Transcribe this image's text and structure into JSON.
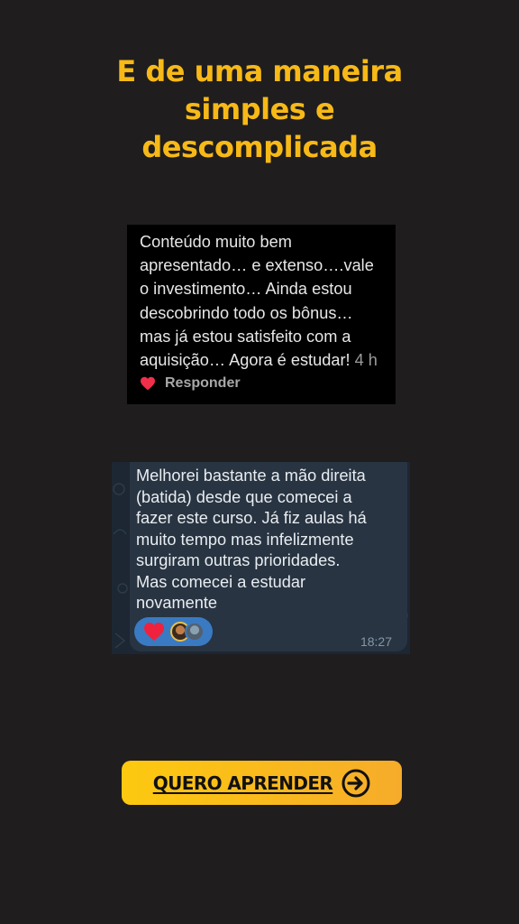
{
  "headline": {
    "lines": [
      "E de uma maneira",
      "simples e",
      "descomplicada"
    ]
  },
  "testimonial_1": {
    "lines": [
      "Conteúdo muito bem",
      "apresentado… e extenso….vale",
      "o investimento… Ainda estou",
      "descobrindo todo os bônus…",
      "mas já estou satisfeito com a",
      "aquisição… Agora é estudar!"
    ],
    "time": "4 h",
    "reply_label": "Responder",
    "icon": "heart-icon"
  },
  "testimonial_2": {
    "lines": [
      "Melhorei bastante a mão direita",
      "(batida) desde que comecei a",
      "fazer este curso. Já fiz aulas há",
      "muito tempo mas infelizmente",
      "surgiram outras prioridades.",
      "Mas comecei a estudar",
      "novamente"
    ],
    "time": "18:27",
    "reaction_icon": "heart-icon"
  },
  "cta": {
    "label": "QUERO APRENDER",
    "icon": "arrow-right-circle-icon"
  },
  "colors": {
    "background": "#1f1d1e",
    "accent": "#f7b917",
    "button_start": "#fdc90f",
    "button_end": "#f6ac2a"
  }
}
